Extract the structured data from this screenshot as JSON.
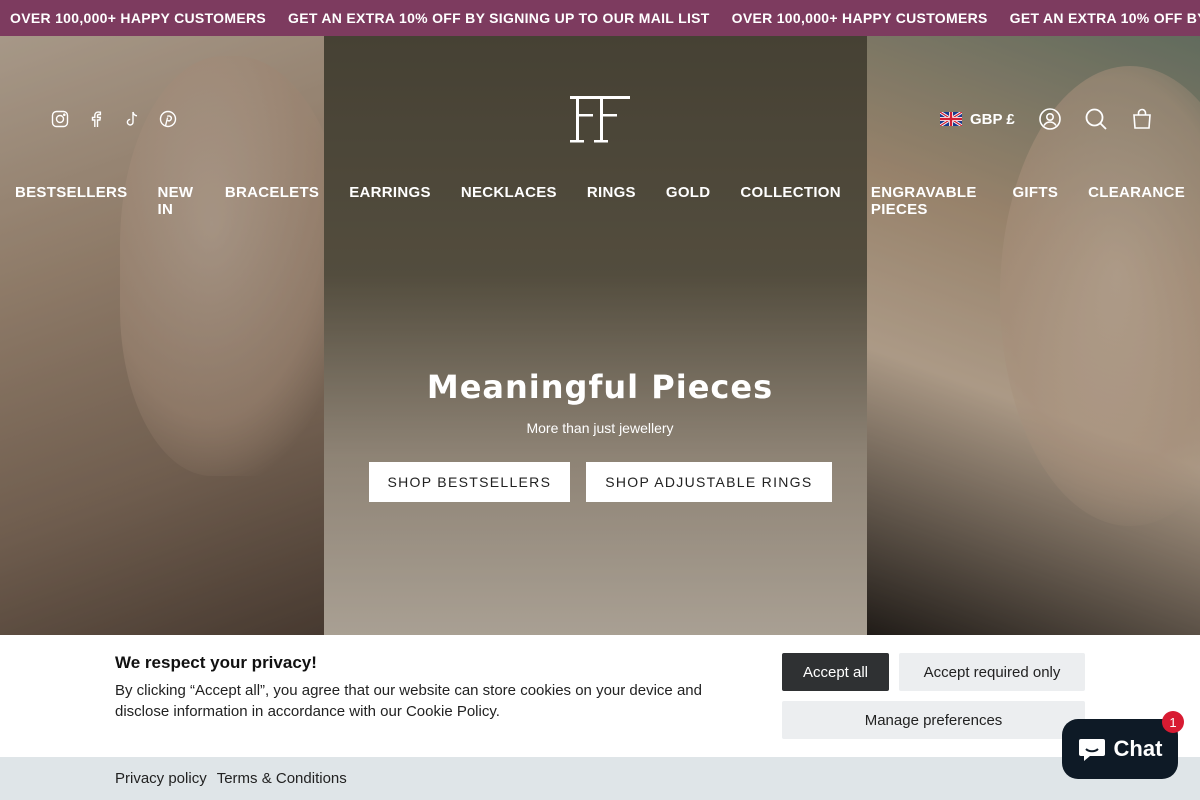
{
  "announcement": {
    "messages": [
      "OVER 100,000+ HAPPY CUSTOMERS",
      "GET AN EXTRA 10% OFF BY SIGNING UP TO OUR MAIL LIST",
      "OVER 100,000+ HAPPY CUSTOMERS",
      "GET AN EXTRA 10% OFF BY SIGNING UP TO OUR MAIL LIST"
    ],
    "background": "#7d3b5f"
  },
  "header": {
    "social_icons": [
      "instagram-icon",
      "facebook-icon",
      "tiktok-icon",
      "pinterest-icon"
    ],
    "currency_label": "GBP £",
    "currency_flag": "uk-flag-icon",
    "tools": [
      "account-icon",
      "search-icon",
      "cart-icon"
    ]
  },
  "nav": {
    "items": [
      "BESTSELLERS",
      "NEW IN",
      "BRACELETS",
      "EARRINGS",
      "NECKLACES",
      "RINGS",
      "GOLD",
      "COLLECTION",
      "ENGRAVABLE PIECES",
      "GIFTS",
      "CLEARANCE"
    ]
  },
  "hero": {
    "title": "Meaningful Pieces",
    "subtitle": "More than just jewellery",
    "buttons": [
      "SHOP BESTSELLERS",
      "SHOP ADJUSTABLE RINGS"
    ]
  },
  "cookie": {
    "heading": "We respect your privacy!",
    "text": "By clicking “Accept all”, you agree that our website can store cookies on your device and disclose information in accordance with our Cookie Policy.",
    "accept_all": "Accept all",
    "accept_required": "Accept required only",
    "manage": "Manage preferences"
  },
  "footer_links": [
    "Privacy policy",
    "Terms & Conditions"
  ],
  "chat": {
    "label": "Chat",
    "badge": "1",
    "color": "#0e1a26",
    "badge_color": "#d81b32"
  }
}
